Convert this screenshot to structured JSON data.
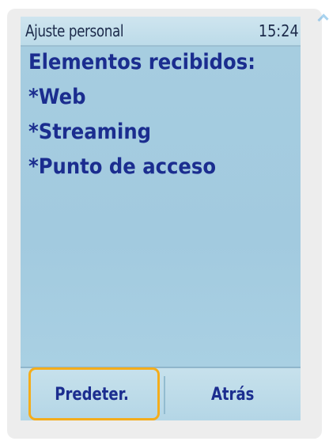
{
  "status_bar": {
    "title": "Ajuste personal",
    "time": "15:24"
  },
  "content": {
    "heading": "Elementos recibidos:",
    "items": [
      "*Web",
      "*Streaming",
      "*Punto de acceso"
    ]
  },
  "softkeys": {
    "left_label": "Predeter.",
    "right_label": "Atrás"
  },
  "colors": {
    "screen_background": "#a8cfe2",
    "text": "#1b2d8f",
    "highlight": "#f4ad1c"
  }
}
